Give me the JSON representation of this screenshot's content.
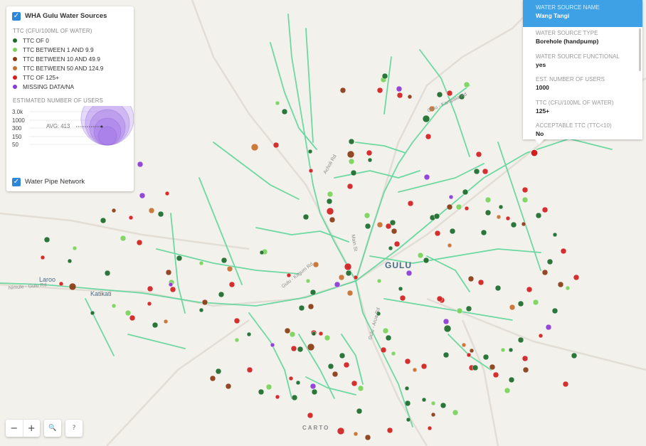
{
  "legend": {
    "layer_title": "WHA Gulu Water Sources",
    "ttc_heading": "TTC (CFU/100ML OF WATER)",
    "categories": [
      {
        "label": "TTC OF 0",
        "color": "#1c6b2a"
      },
      {
        "label": "TTC BETWEEN 1 AND 9.9",
        "color": "#7ad45a"
      },
      {
        "label": "TTC BETWEEN 10 AND 49.9",
        "color": "#8a3b12"
      },
      {
        "label": "TTC BETWEEN 50 AND 124.9",
        "color": "#c8702e"
      },
      {
        "label": "TTC OF 125+",
        "color": "#d11f1f"
      },
      {
        "label": "MISSING DATA/NA",
        "color": "#8b3ad6"
      }
    ],
    "users_heading": "ESTIMATED NUMBER OF USERS",
    "size_labels": [
      "3.0k",
      "1000",
      "300",
      "150",
      "50"
    ],
    "avg_label": "AVG: 413",
    "bubble_color": "#a57be8",
    "pipe_layer_title": "Water Pipe Network",
    "pipe_color": "#5ed69a"
  },
  "popup": {
    "title_label": "WATER SOURCE NAME",
    "title_value": "Wang Tangi",
    "fields": [
      {
        "label": "WATER SOURCE TYPE",
        "value": "Borehole (handpump)"
      },
      {
        "label": "WATER SOURCE FUNCTIONAL",
        "value": "yes"
      },
      {
        "label": "EST. NUMBER OF USERS",
        "value": "1000"
      },
      {
        "label": "TTC (CFU/100ML OF WATER)",
        "value": "125+"
      },
      {
        "label": "ACCEPTABLE TTC (TTC<10)",
        "value": "No"
      }
    ]
  },
  "map_labels": {
    "city": "GULU",
    "katikati": "Katikati",
    "laroo": "Laroo",
    "road_nimule": "Nimule - Gulu Rd",
    "road_gulu_kampala": "Gulu - Kampala Rd",
    "road_gulu_kitgum": "Gulu - Kitgum Rd",
    "road_acholi": "Acholi Rd",
    "road_main": "Main St",
    "road_gulu_arua": "Gulu - Arua Rd",
    "attribution": "CARTO"
  },
  "controls": {
    "zoom_out": "−",
    "zoom_in": "+",
    "search": "🔍",
    "help": "?"
  }
}
